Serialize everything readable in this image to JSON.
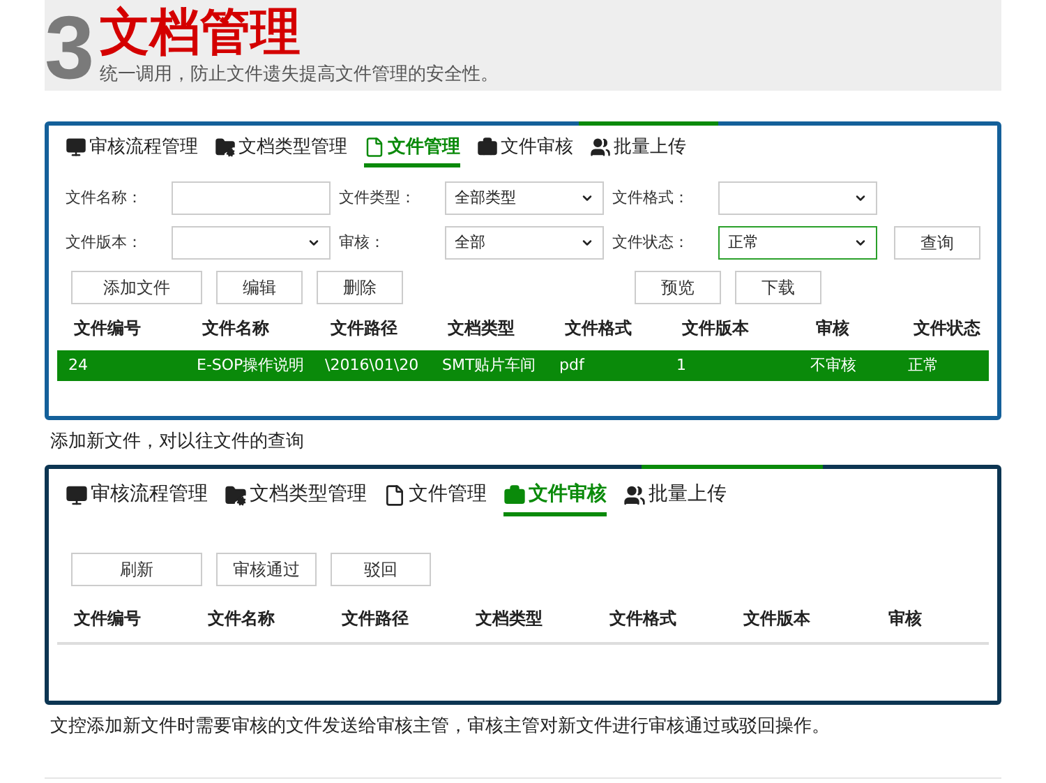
{
  "header": {
    "number": "3",
    "title": "文档管理",
    "subtitle": "统一调用，防止文件遗失提高文件管理的安全性。"
  },
  "panels": [
    {
      "tabs": [
        {
          "label": "审核流程管理",
          "selected": false
        },
        {
          "label": "文档类型管理",
          "selected": false
        },
        {
          "label": "文件管理",
          "selected": true
        },
        {
          "label": "文件审核",
          "selected": false
        },
        {
          "label": "批量上传",
          "selected": false
        }
      ],
      "filters": [
        {
          "label": "文件名称：",
          "kind": "text",
          "focused": false
        },
        {
          "label": "文件类型：",
          "kind": "select",
          "value": "全部类型",
          "focused": false
        },
        {
          "label": "文件格式：",
          "kind": "select",
          "focused": false
        },
        {
          "label": "文件版本：",
          "kind": "select",
          "focused": false
        },
        {
          "label": "审核：",
          "kind": "select",
          "value": "全部",
          "focused": false
        },
        {
          "label": "文件状态：",
          "kind": "select",
          "value": "正常",
          "focused": true
        }
      ],
      "query_button": "查询",
      "buttons": [
        "添加文件",
        "编辑",
        "删除"
      ],
      "right_buttons": [
        "预览",
        "下载"
      ],
      "table": {
        "columns": [
          "文件编号",
          "文件名称",
          "文件路径",
          "文档类型",
          "文件格式",
          "文件版本",
          "审核",
          "文件状态"
        ],
        "rows": [
          {
            "selected": true,
            "cells": [
              "24",
              "E-SOP操作说明",
              "\\2016\\01\\20",
              "SMT贴片车间",
              "pdf",
              "1",
              "不审核",
              "正常"
            ]
          }
        ]
      },
      "caption": "添加新文件，对以往文件的查询"
    },
    {
      "tabs": [
        {
          "label": "审核流程管理",
          "selected": false
        },
        {
          "label": "文档类型管理",
          "selected": false
        },
        {
          "label": "文件管理",
          "selected": false
        },
        {
          "label": "文件审核",
          "selected": true
        },
        {
          "label": "批量上传",
          "selected": false
        }
      ],
      "buttons": [
        "刷新",
        "审核通过",
        "驳回"
      ],
      "table": {
        "columns": [
          "文件编号",
          "文件名称",
          "文件路径",
          "文档类型",
          "文件格式",
          "文件版本",
          "审核"
        ]
      },
      "caption": "文控添加新文件时需要审核的文件发送给审核主管，审核主管对新文件进行审核通过或驳回操作。"
    }
  ]
}
